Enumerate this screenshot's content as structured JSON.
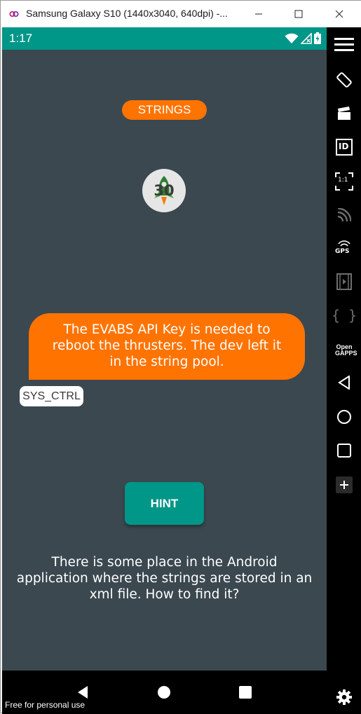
{
  "window": {
    "title": "Samsung Galaxy S10 (1440x3040, 640dpi) -..."
  },
  "statusbar": {
    "time": "1:17"
  },
  "screen": {
    "category_pill": "STRINGS",
    "badge_number": "30",
    "bubble_text": "The EVABS API Key is needed to reboot the thrusters. The dev left it in the string pool.",
    "tag": "SYS_CTRL",
    "hint_button": "HINT",
    "hint_text": "There is some place in the Android application where the strings are stored in an xml file. How to find it?"
  },
  "watermark": "Free for personal use",
  "sidebar": {
    "items": [
      "menu-icon",
      "rotate-icon",
      "clapper-icon",
      "id-icon",
      "pixel-perfect-icon",
      "cast-icon",
      "gps-icon",
      "media-icon",
      "code-braces-icon",
      "open-gapps-icon",
      "back-icon",
      "home-icon",
      "recents-icon",
      "plus-icon",
      "gear-icon"
    ],
    "id_label": "ID",
    "gps_label": "GPS",
    "gapps_label": "Open GAPPS",
    "pixel_label": "1:1",
    "braces_label": "{ }"
  },
  "colors": {
    "accent": "#ff7300",
    "teal": "#009688",
    "screen_bg": "#3b4850"
  }
}
